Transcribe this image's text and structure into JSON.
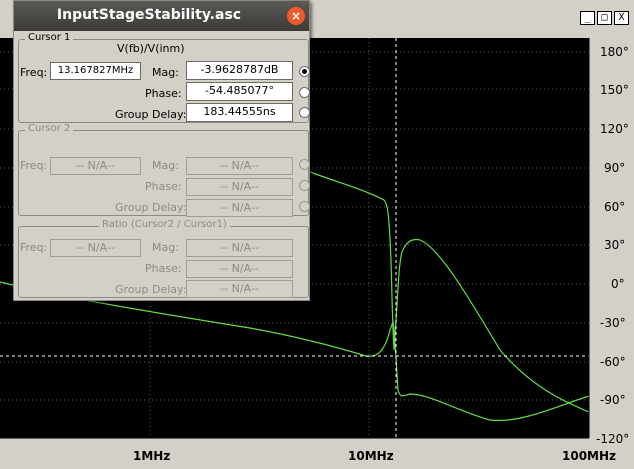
{
  "window": {
    "controls": {
      "minimize": "_",
      "maximize": "□",
      "close": "X"
    }
  },
  "plot": {
    "background": "#000000",
    "trace_color": "#66dd44",
    "cursor_color": "#ffffff",
    "x_ticks": [
      "1MHz",
      "10MHz",
      "100MHz"
    ],
    "y_ticks": [
      "180°",
      "150°",
      "120°",
      "90°",
      "60°",
      "30°",
      "0°",
      "-30°",
      "-60°",
      "-90°",
      "-120°"
    ]
  },
  "dialog": {
    "title": "InputStageStability.asc",
    "close_icon": "×",
    "cursor1": {
      "title": "Cursor 1",
      "expression": "V(fb)/V(inm)",
      "freq_label": "Freq:",
      "freq_value": "13.167827MHz",
      "mag_label": "Mag:",
      "mag_value": "-3.9628787dB",
      "phase_label": "Phase:",
      "phase_value": "-54.485077°",
      "gd_label": "Group Delay:",
      "gd_value": "183.44555ns"
    },
    "cursor2": {
      "title": "Cursor 2",
      "freq_label": "Freq:",
      "freq_value": "-- N/A--",
      "mag_label": "Mag:",
      "mag_value": "-- N/A--",
      "phase_label": "Phase:",
      "phase_value": "-- N/A--",
      "gd_label": "Group Delay:",
      "gd_value": "-- N/A--"
    },
    "ratio": {
      "title": "Ratio (Cursor2 / Cursor1)",
      "freq_label": "Freq:",
      "freq_value": "-- N/A--",
      "mag_label": "Mag:",
      "mag_value": "-- N/A--",
      "phase_label": "Phase:",
      "phase_value": "-- N/A--",
      "gd_label": "Group Delay:",
      "gd_value": "-- N/A--"
    }
  }
}
